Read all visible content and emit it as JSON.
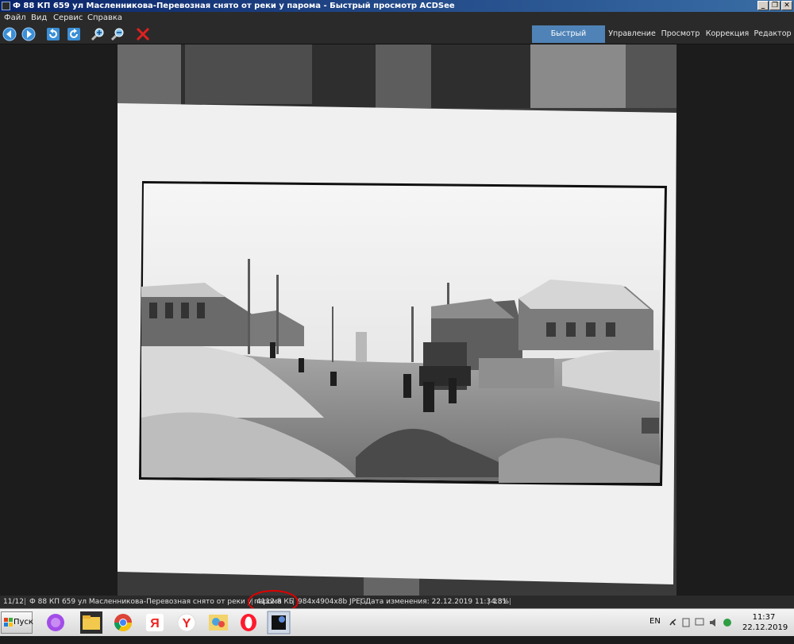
{
  "window": {
    "title": "Ф 88 КП 659 ул Масленникова-Перевозная снято от реки у парома - Быстрый просмотр ACDSee",
    "minimize": "_",
    "restore": "❐",
    "close": "✕"
  },
  "menu": {
    "file": "Файл",
    "view": "Вид",
    "service": "Сервис",
    "help": "Справка"
  },
  "toolbar": {
    "icons": [
      "prev-arrow-icon",
      "next-arrow-icon",
      "rotate-left-icon",
      "rotate-right-icon",
      "zoom-in-icon",
      "zoom-out-icon",
      "delete-icon"
    ],
    "tabs": {
      "quick_view": "Быстрый просмотр",
      "manage": "Управление",
      "view": "Просмотр",
      "develop": "Коррекция",
      "edit": "Редактор"
    }
  },
  "status": {
    "index": "11/12",
    "filename": "Ф 88 КП 659 ул Масленникова-Перевозная снято от реки у парома",
    "filesize": "4112.8 КБ",
    "dimensions": "984x4904x8b JPEG",
    "modified": "Дата изменения: 22.12.2019 11:34:31",
    "zoom": "18%",
    "highlight_color": "#e00000"
  },
  "taskbar": {
    "start_label": "Пуск",
    "apps": [
      "alice-icon",
      "explorer-icon",
      "chrome-icon",
      "yandex-icon",
      "yandex-browser-icon",
      "paint-icon",
      "opera-icon",
      "acdsee-icon"
    ],
    "lang": "EN",
    "time": "11:37",
    "date": "22.12.2019"
  }
}
